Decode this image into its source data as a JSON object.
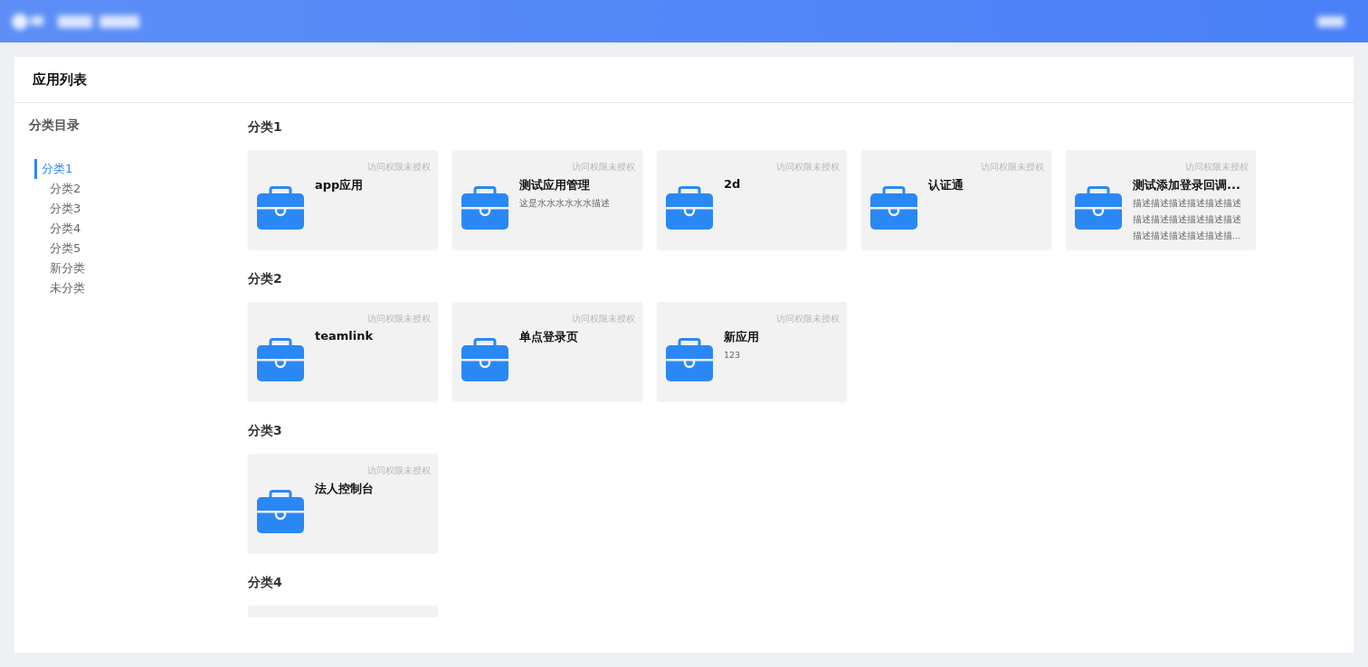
{
  "page": {
    "title": "应用列表"
  },
  "sidebar": {
    "title": "分类目录",
    "items": [
      {
        "label": "分类1",
        "selected": true
      },
      {
        "label": "分类2",
        "selected": false
      },
      {
        "label": "分类3",
        "selected": false
      },
      {
        "label": "分类4",
        "selected": false
      },
      {
        "label": "分类5",
        "selected": false
      },
      {
        "label": "新分类",
        "selected": false
      },
      {
        "label": "未分类",
        "selected": false
      }
    ]
  },
  "sections": [
    {
      "title": "分类1",
      "cards": [
        {
          "status": "访问权限未授权",
          "title": "app应用"
        },
        {
          "status": "访问权限未授权",
          "title": "测试应用管理",
          "description_lines": [
            "这是水水水水水水描述"
          ]
        },
        {
          "status": "访问权限未授权",
          "title": "2d"
        },
        {
          "status": "访问权限未授权",
          "title": "认证通"
        },
        {
          "status": "访问权限未授权",
          "title": "测试添加登录回调...",
          "description_lines": [
            "描述描述描述描述描述描述",
            "描述描述描述描述描述描述",
            "描述描述描述描述描述描..."
          ]
        }
      ]
    },
    {
      "title": "分类2",
      "cards": [
        {
          "status": "访问权限未授权",
          "title": "teamlink"
        },
        {
          "status": "访问权限未授权",
          "title": "单点登录页"
        },
        {
          "status": "访问权限未授权",
          "title": "新应用",
          "description_lines": [
            "123"
          ]
        }
      ]
    },
    {
      "title": "分类3",
      "cards": [
        {
          "status": "访问权限未授权",
          "title": "法人控制台"
        }
      ]
    },
    {
      "title": "分类4",
      "cards": [
        {
          "kind": "clipped"
        }
      ]
    }
  ]
}
